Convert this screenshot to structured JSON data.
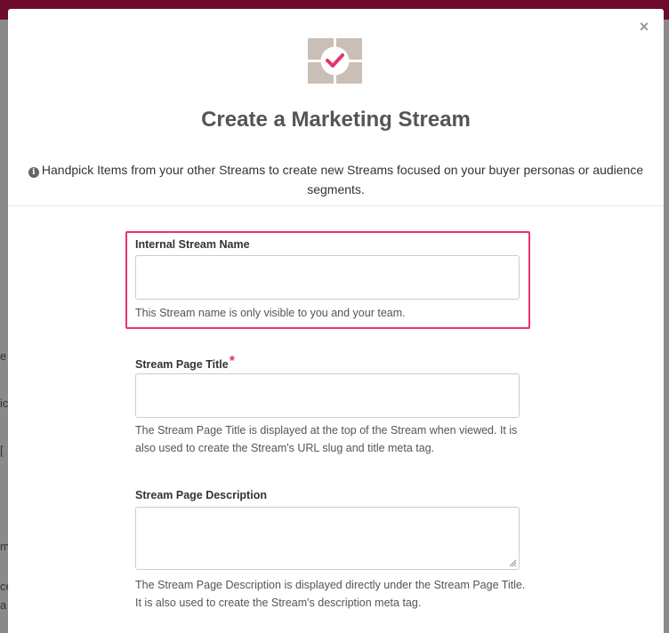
{
  "modal": {
    "close_label": "×",
    "title": "Create a Marketing Stream",
    "info_text": "Handpick Items from your other Streams to create new Streams focused on your buyer personas or audience segments.",
    "colors": {
      "accent": "#e8336e",
      "logo_tile": "#c9bfb6",
      "top_bar": "#6e0a2e"
    }
  },
  "background": {
    "fragments": [
      "e",
      "ic",
      "[",
      "m",
      "ce",
      "a"
    ]
  },
  "form": {
    "internal_name": {
      "label": "Internal Stream Name",
      "value": "",
      "help": "This Stream name is only visible to you and your team."
    },
    "page_title": {
      "label": "Stream Page Title",
      "required_mark": "*",
      "value": "",
      "help": "The Stream Page Title is displayed at the top of the Stream when viewed. It is also used to create the Stream's URL slug and title meta tag."
    },
    "page_description": {
      "label": "Stream Page Description",
      "value": "",
      "help": "The Stream Page Description is displayed directly under the Stream Page Title. It is also used to create the Stream's description meta tag."
    }
  }
}
